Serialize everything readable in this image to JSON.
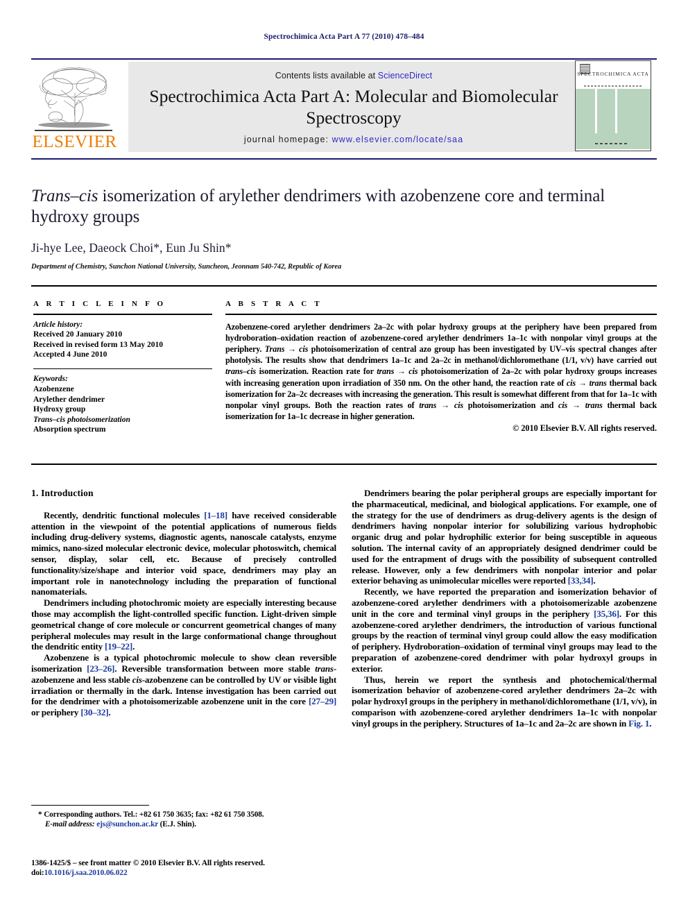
{
  "running_head": "Spectrochimica Acta Part A 77 (2010) 478–484",
  "masthead": {
    "contents_prefix": "Contents lists available at ",
    "sciencedirect": "ScienceDirect",
    "journal_title": "Spectrochimica Acta Part A: Molecular and Biomolecular Spectroscopy",
    "homepage_prefix": "journal homepage: ",
    "homepage_url": "www.elsevier.com/locate/saa",
    "publisher": "ELSEVIER",
    "cover_name": "SPECTROCHIMICA ACTA",
    "link_color": "#2b2bc8",
    "band_color": "#e8e8e8",
    "cover_color": "#b9d4be",
    "elsevier_orange": "#f07d00"
  },
  "title": {
    "italic_lead": "Trans–cis",
    "rest": " isomerization of arylether dendrimers with azobenzene core and terminal hydroxy groups"
  },
  "authors": "Ji-hye Lee, Daeock Choi*, Eun Ju Shin*",
  "affiliation": "Department of Chemistry, Sunchon National University, Suncheon, Jeonnam 540-742, Republic of Korea",
  "article_info": {
    "heading": "A R T I C L E   I N F O",
    "history_label": "Article history:",
    "history": [
      "Received 20 January 2010",
      "Received in revised form 13 May 2010",
      "Accepted 4 June 2010"
    ],
    "keywords_label": "Keywords:",
    "keywords": [
      "Azobenzene",
      "Arylether dendrimer",
      "Hydroxy group",
      "Trans–cis photoisomerization",
      "Absorption spectrum"
    ]
  },
  "abstract": {
    "heading": "A B S T R A C T",
    "copyright": "© 2010 Elsevier B.V. All rights reserved.",
    "text_parts": [
      {
        "t": "Azobenzene-cored arylether dendrimers "
      },
      {
        "t": "2a–2c",
        "s": "bold"
      },
      {
        "t": " with polar hydroxy groups at the periphery have been prepared from hydroboration–oxidation reaction of azobenzene-cored arylether dendrimers "
      },
      {
        "t": "1a–1c",
        "s": "bold"
      },
      {
        "t": " with nonpolar vinyl groups at the periphery. "
      },
      {
        "t": "Trans → cis",
        "s": "italic"
      },
      {
        "t": " photoisomerization of central azo group has been investigated by UV–vis spectral changes after photolysis. The results show that dendrimers "
      },
      {
        "t": "1a–1c",
        "s": "bold"
      },
      {
        "t": " and "
      },
      {
        "t": "2a–2c",
        "s": "bold"
      },
      {
        "t": " in methanol/dichloromethane (1/1, v/v) have carried out "
      },
      {
        "t": "trans–cis",
        "s": "italic"
      },
      {
        "t": " isomerization. Reaction rate for "
      },
      {
        "t": "trans → cis",
        "s": "italic"
      },
      {
        "t": " photoisomerization of "
      },
      {
        "t": "2a–2c",
        "s": "bold"
      },
      {
        "t": " with polar hydroxy groups increases with increasing generation upon irradiation of 350 nm. On the other hand, the reaction rate of "
      },
      {
        "t": "cis → trans",
        "s": "italic"
      },
      {
        "t": " thermal back isomerization for "
      },
      {
        "t": "2a–2c",
        "s": "bold"
      },
      {
        "t": " decreases with increasing the generation. This result is somewhat different from that for "
      },
      {
        "t": "1a–1c",
        "s": "bold"
      },
      {
        "t": " with nonpolar vinyl groups. Both the reaction rates of "
      },
      {
        "t": "trans → cis",
        "s": "italic"
      },
      {
        "t": " photoisomerization and "
      },
      {
        "t": "cis → trans",
        "s": "italic"
      },
      {
        "t": " thermal back isomerization for "
      },
      {
        "t": "1a–1c",
        "s": "bold"
      },
      {
        "t": " decrease in higher generation."
      }
    ]
  },
  "body": {
    "section_heading": "1. Introduction",
    "left_paragraphs": [
      "Recently, dendritic functional molecules [1–18] have received considerable attention in the viewpoint of the potential applications of numerous fields including drug-delivery systems, diagnostic agents, nanoscale catalysts, enzyme mimics, nano-sized molecular electronic device, molecular photoswitch, chemical sensor, display, solar cell, etc. Because of precisely controlled functionality/size/shape and interior void space, dendrimers may play an important role in nanotechnology including the preparation of functional nanomaterials.",
      "Dendrimers including photochromic moiety are especially interesting because those may accomplish the light-controlled specific function. Light-driven simple geometrical change of core molecule or concurrent geometrical changes of many peripheral molecules may result in the large conformational change throughout the dendritic entity [19–22].",
      "Azobenzene is a typical photochromic molecule to show clean reversible isomerization [23–26]. Reversible transformation between more stable trans-azobenzene and less stable cis-azobenzene can be controlled by UV or visible light irradiation or thermally in the dark. Intense investigation has been carried out for the dendrimer with a photoisomerizable azobenzene unit in the core [27–29] or periphery [30–32]."
    ],
    "right_paragraphs": [
      "Dendrimers bearing the polar peripheral groups are especially important for the pharmaceutical, medicinal, and biological applications. For example, one of the strategy for the use of dendrimers as drug-delivery agents is the design of dendrimers having nonpolar interior for solubilizing various hydrophobic organic drug and polar hydrophilic exterior for being susceptible in aqueous solution. The internal cavity of an appropriately designed dendrimer could be used for the entrapment of drugs with the possibility of subsequent controlled release. However, only a few dendrimers with nonpolar interior and polar exterior behaving as unimolecular micelles were reported [33,34].",
      "Recently, we have reported the preparation and isomerization behavior of azobenzene-cored arylether dendrimers with a photoisomerizable azobenzene unit in the core and terminal vinyl groups in the periphery [35,36]. For this azobenzene-cored arylether dendrimers, the introduction of various functional groups by the reaction of terminal vinyl group could allow the easy modification of periphery. Hydroboration–oxidation of terminal vinyl groups may lead to the preparation of azobenzene-cored dendrimer with polar hydroxyl groups in exterior.",
      "Thus, herein we report the synthesis and photochemical/thermal isomerization behavior of azobenzene-cored arylether dendrimers 2a–2c with polar hydroxyl groups in the periphery in methanol/dichloromethane (1/1, v/v), in comparison with azobenzene-cored arylether dendrimers 1a–1c with nonpolar vinyl groups in the periphery. Structures of 1a–1c and 2a–2c are shown in Fig. 1."
    ]
  },
  "footnotes": {
    "corresponding": "* Corresponding authors. Tel.: +82 61 750 3635; fax: +82 61 750 3508.",
    "email_label": "E-mail address:",
    "email": "ejs@sunchon.ac.kr",
    "email_suffix": " (E.J. Shin).",
    "imprint_line1": "1386-1425/$ – see front matter © 2010 Elsevier B.V. All rights reserved.",
    "doi_label": "doi:",
    "doi": "10.1016/j.saa.2010.06.022"
  }
}
